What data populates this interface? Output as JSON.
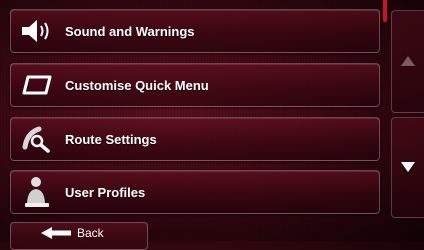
{
  "menu": {
    "items": [
      {
        "label": "Sound and Warnings",
        "icon": "speaker-icon"
      },
      {
        "label": "Customise Quick Menu",
        "icon": "quick-menu-icon"
      },
      {
        "label": "Route Settings",
        "icon": "route-settings-icon"
      },
      {
        "label": "User Profiles",
        "icon": "user-profile-icon"
      }
    ]
  },
  "footer": {
    "back_label": "Back"
  },
  "colors": {
    "accent": "#c8142a",
    "background": "#3a0812",
    "text": "#ffffff"
  }
}
